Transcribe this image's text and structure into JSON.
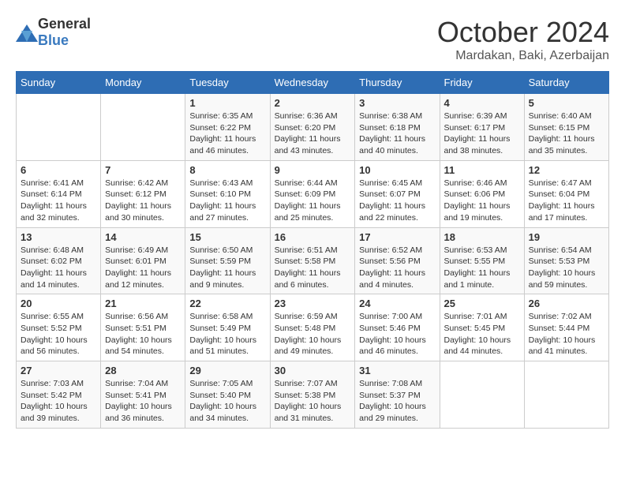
{
  "logo": {
    "general": "General",
    "blue": "Blue"
  },
  "header": {
    "month": "October 2024",
    "location": "Mardakan, Baki, Azerbaijan"
  },
  "weekdays": [
    "Sunday",
    "Monday",
    "Tuesday",
    "Wednesday",
    "Thursday",
    "Friday",
    "Saturday"
  ],
  "weeks": [
    [
      {
        "day": "",
        "sunrise": "",
        "sunset": "",
        "daylight": ""
      },
      {
        "day": "",
        "sunrise": "",
        "sunset": "",
        "daylight": ""
      },
      {
        "day": "1",
        "sunrise": "Sunrise: 6:35 AM",
        "sunset": "Sunset: 6:22 PM",
        "daylight": "Daylight: 11 hours and 46 minutes."
      },
      {
        "day": "2",
        "sunrise": "Sunrise: 6:36 AM",
        "sunset": "Sunset: 6:20 PM",
        "daylight": "Daylight: 11 hours and 43 minutes."
      },
      {
        "day": "3",
        "sunrise": "Sunrise: 6:38 AM",
        "sunset": "Sunset: 6:18 PM",
        "daylight": "Daylight: 11 hours and 40 minutes."
      },
      {
        "day": "4",
        "sunrise": "Sunrise: 6:39 AM",
        "sunset": "Sunset: 6:17 PM",
        "daylight": "Daylight: 11 hours and 38 minutes."
      },
      {
        "day": "5",
        "sunrise": "Sunrise: 6:40 AM",
        "sunset": "Sunset: 6:15 PM",
        "daylight": "Daylight: 11 hours and 35 minutes."
      }
    ],
    [
      {
        "day": "6",
        "sunrise": "Sunrise: 6:41 AM",
        "sunset": "Sunset: 6:14 PM",
        "daylight": "Daylight: 11 hours and 32 minutes."
      },
      {
        "day": "7",
        "sunrise": "Sunrise: 6:42 AM",
        "sunset": "Sunset: 6:12 PM",
        "daylight": "Daylight: 11 hours and 30 minutes."
      },
      {
        "day": "8",
        "sunrise": "Sunrise: 6:43 AM",
        "sunset": "Sunset: 6:10 PM",
        "daylight": "Daylight: 11 hours and 27 minutes."
      },
      {
        "day": "9",
        "sunrise": "Sunrise: 6:44 AM",
        "sunset": "Sunset: 6:09 PM",
        "daylight": "Daylight: 11 hours and 25 minutes."
      },
      {
        "day": "10",
        "sunrise": "Sunrise: 6:45 AM",
        "sunset": "Sunset: 6:07 PM",
        "daylight": "Daylight: 11 hours and 22 minutes."
      },
      {
        "day": "11",
        "sunrise": "Sunrise: 6:46 AM",
        "sunset": "Sunset: 6:06 PM",
        "daylight": "Daylight: 11 hours and 19 minutes."
      },
      {
        "day": "12",
        "sunrise": "Sunrise: 6:47 AM",
        "sunset": "Sunset: 6:04 PM",
        "daylight": "Daylight: 11 hours and 17 minutes."
      }
    ],
    [
      {
        "day": "13",
        "sunrise": "Sunrise: 6:48 AM",
        "sunset": "Sunset: 6:02 PM",
        "daylight": "Daylight: 11 hours and 14 minutes."
      },
      {
        "day": "14",
        "sunrise": "Sunrise: 6:49 AM",
        "sunset": "Sunset: 6:01 PM",
        "daylight": "Daylight: 11 hours and 12 minutes."
      },
      {
        "day": "15",
        "sunrise": "Sunrise: 6:50 AM",
        "sunset": "Sunset: 5:59 PM",
        "daylight": "Daylight: 11 hours and 9 minutes."
      },
      {
        "day": "16",
        "sunrise": "Sunrise: 6:51 AM",
        "sunset": "Sunset: 5:58 PM",
        "daylight": "Daylight: 11 hours and 6 minutes."
      },
      {
        "day": "17",
        "sunrise": "Sunrise: 6:52 AM",
        "sunset": "Sunset: 5:56 PM",
        "daylight": "Daylight: 11 hours and 4 minutes."
      },
      {
        "day": "18",
        "sunrise": "Sunrise: 6:53 AM",
        "sunset": "Sunset: 5:55 PM",
        "daylight": "Daylight: 11 hours and 1 minute."
      },
      {
        "day": "19",
        "sunrise": "Sunrise: 6:54 AM",
        "sunset": "Sunset: 5:53 PM",
        "daylight": "Daylight: 10 hours and 59 minutes."
      }
    ],
    [
      {
        "day": "20",
        "sunrise": "Sunrise: 6:55 AM",
        "sunset": "Sunset: 5:52 PM",
        "daylight": "Daylight: 10 hours and 56 minutes."
      },
      {
        "day": "21",
        "sunrise": "Sunrise: 6:56 AM",
        "sunset": "Sunset: 5:51 PM",
        "daylight": "Daylight: 10 hours and 54 minutes."
      },
      {
        "day": "22",
        "sunrise": "Sunrise: 6:58 AM",
        "sunset": "Sunset: 5:49 PM",
        "daylight": "Daylight: 10 hours and 51 minutes."
      },
      {
        "day": "23",
        "sunrise": "Sunrise: 6:59 AM",
        "sunset": "Sunset: 5:48 PM",
        "daylight": "Daylight: 10 hours and 49 minutes."
      },
      {
        "day": "24",
        "sunrise": "Sunrise: 7:00 AM",
        "sunset": "Sunset: 5:46 PM",
        "daylight": "Daylight: 10 hours and 46 minutes."
      },
      {
        "day": "25",
        "sunrise": "Sunrise: 7:01 AM",
        "sunset": "Sunset: 5:45 PM",
        "daylight": "Daylight: 10 hours and 44 minutes."
      },
      {
        "day": "26",
        "sunrise": "Sunrise: 7:02 AM",
        "sunset": "Sunset: 5:44 PM",
        "daylight": "Daylight: 10 hours and 41 minutes."
      }
    ],
    [
      {
        "day": "27",
        "sunrise": "Sunrise: 7:03 AM",
        "sunset": "Sunset: 5:42 PM",
        "daylight": "Daylight: 10 hours and 39 minutes."
      },
      {
        "day": "28",
        "sunrise": "Sunrise: 7:04 AM",
        "sunset": "Sunset: 5:41 PM",
        "daylight": "Daylight: 10 hours and 36 minutes."
      },
      {
        "day": "29",
        "sunrise": "Sunrise: 7:05 AM",
        "sunset": "Sunset: 5:40 PM",
        "daylight": "Daylight: 10 hours and 34 minutes."
      },
      {
        "day": "30",
        "sunrise": "Sunrise: 7:07 AM",
        "sunset": "Sunset: 5:38 PM",
        "daylight": "Daylight: 10 hours and 31 minutes."
      },
      {
        "day": "31",
        "sunrise": "Sunrise: 7:08 AM",
        "sunset": "Sunset: 5:37 PM",
        "daylight": "Daylight: 10 hours and 29 minutes."
      },
      {
        "day": "",
        "sunrise": "",
        "sunset": "",
        "daylight": ""
      },
      {
        "day": "",
        "sunrise": "",
        "sunset": "",
        "daylight": ""
      }
    ]
  ]
}
